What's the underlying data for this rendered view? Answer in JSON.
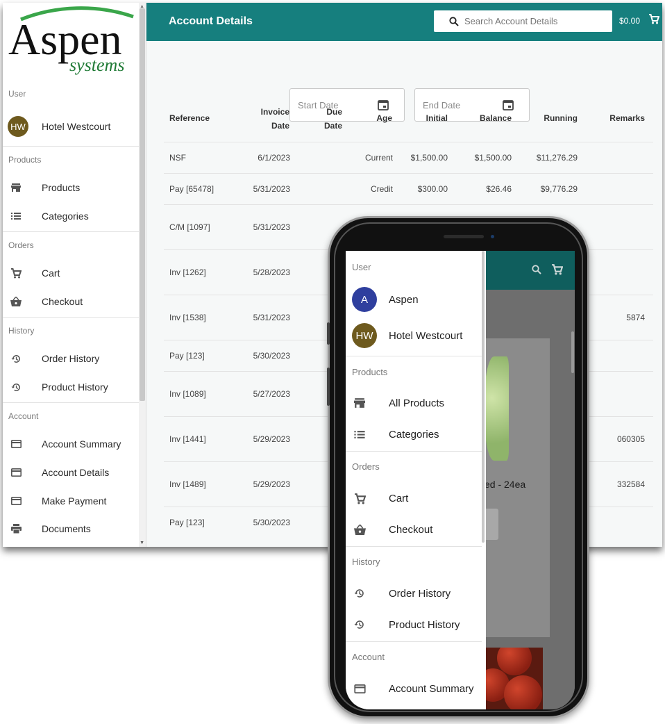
{
  "brand": {
    "logo_main": "Aspen",
    "logo_sub": "systems"
  },
  "sidebar": {
    "user_header": "User",
    "user": {
      "initials": "HW",
      "name": "Hotel Westcourt"
    },
    "products_header": "Products",
    "products": [
      {
        "label": "Products",
        "icon": "store-icon"
      },
      {
        "label": "Categories",
        "icon": "list-icon"
      }
    ],
    "orders_header": "Orders",
    "orders": [
      {
        "label": "Cart",
        "icon": "cart-icon"
      },
      {
        "label": "Checkout",
        "icon": "basket-icon"
      }
    ],
    "history_header": "History",
    "history": [
      {
        "label": "Order History",
        "icon": "history-icon"
      },
      {
        "label": "Product History",
        "icon": "history-icon"
      }
    ],
    "account_header": "Account",
    "account": [
      {
        "label": "Account Summary",
        "icon": "card-icon"
      },
      {
        "label": "Account Details",
        "icon": "card-icon"
      },
      {
        "label": "Make Payment",
        "icon": "card-icon"
      },
      {
        "label": "Documents",
        "icon": "printer-icon"
      }
    ]
  },
  "topbar": {
    "title": "Account Details",
    "search_placeholder": "Search Account Details",
    "cart_amount": "$0.00"
  },
  "filters": {
    "start_date": "Start Date",
    "end_date": "End Date"
  },
  "table": {
    "headers": {
      "reference": "Reference",
      "invoice_date_1": "Invoice",
      "invoice_date_2": "Date",
      "due_date_1": "Due",
      "due_date_2": "Date",
      "age": "Age",
      "initial": "Initial",
      "balance": "Balance",
      "running": "Running",
      "remarks": "Remarks"
    },
    "rows": [
      {
        "ref": "NSF",
        "date": "6/1/2023",
        "age": "Current",
        "initial": "$1,500.00",
        "balance": "$1,500.00",
        "running": "$11,276.29",
        "remarks": ""
      },
      {
        "ref": "Pay [65478]",
        "date": "5/31/2023",
        "age": "Credit",
        "initial": "$300.00",
        "balance": "$26.46",
        "running": "$9,776.29",
        "remarks": ""
      },
      {
        "ref": "C/M [1097]",
        "date": "5/31/2023",
        "age": "",
        "initial": "",
        "balance": "",
        "running": "",
        "remarks": ""
      },
      {
        "ref": "Inv [1262]",
        "date": "5/28/2023",
        "age": "",
        "initial": "",
        "balance": "",
        "running": "",
        "remarks": ""
      },
      {
        "ref": "Inv [1538]",
        "date": "5/31/2023",
        "age": "",
        "initial": "",
        "balance": "",
        "running": "",
        "remarks": "5874"
      },
      {
        "ref": "Pay [123]",
        "date": "5/30/2023",
        "age": "",
        "initial": "",
        "balance": "",
        "running": "",
        "remarks": ""
      },
      {
        "ref": "Inv [1089]",
        "date": "5/27/2023",
        "age": "",
        "initial": "",
        "balance": "",
        "running": "",
        "remarks": ""
      },
      {
        "ref": "Inv [1441]",
        "date": "5/29/2023",
        "age": "",
        "initial": "",
        "balance": "",
        "running": "",
        "remarks": "060305"
      },
      {
        "ref": "Inv [1489]",
        "date": "5/29/2023",
        "age": "",
        "initial": "",
        "balance": "",
        "running": "",
        "remarks": "332584"
      },
      {
        "ref": "Pay [123]",
        "date": "5/30/2023",
        "age": "",
        "initial": "",
        "balance": "",
        "running": "",
        "remarks": ""
      }
    ]
  },
  "phone": {
    "user_header": "User",
    "users": [
      {
        "initials": "A",
        "name": "Aspen",
        "color": "#2f3f9e"
      },
      {
        "initials": "HW",
        "name": "Hotel Westcourt",
        "color": "#6e5a1e"
      }
    ],
    "products_header": "Products",
    "products": [
      "All Products",
      "Categories"
    ],
    "orders_header": "Orders",
    "orders": [
      "Cart",
      "Checkout"
    ],
    "history_header": "History",
    "history": [
      "Order History",
      "Product History"
    ],
    "account_header": "Account",
    "account": [
      "Account Summary"
    ],
    "product_partial": "ed - 24ea"
  },
  "colors": {
    "teal": "#167f7e",
    "avatar_brown": "#6e5a1e",
    "avatar_blue": "#2f3f9e",
    "logo_green": "#3aa64a"
  }
}
